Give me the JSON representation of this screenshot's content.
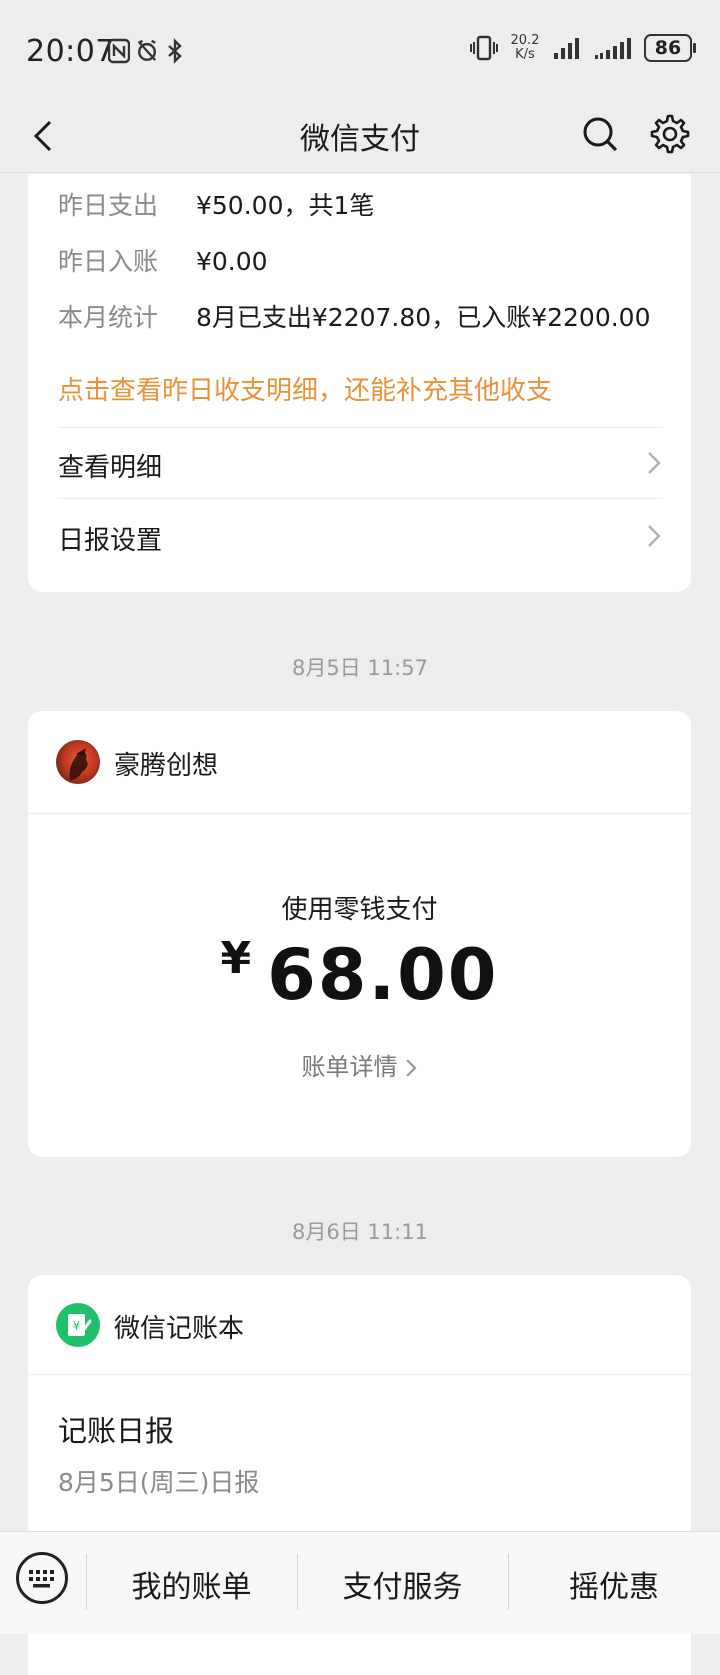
{
  "status": {
    "time": "20:07",
    "net_speed_value": "20.2",
    "net_speed_unit": "K/s",
    "battery": "86"
  },
  "header": {
    "title": "微信支付"
  },
  "summary": {
    "yesterday_out_label": "昨日支出",
    "yesterday_out_value": "¥50.00，共1笔",
    "yesterday_in_label": "昨日入账",
    "yesterday_in_value": "¥0.00",
    "month_label": "本月统计",
    "month_value": "8月已支出¥2207.80，已入账¥2200.00",
    "hint": "点击查看昨日收支明细，还能补充其他收支",
    "view_details": "查看明细",
    "report_settings": "日报设置"
  },
  "timestamps": {
    "first": "8月5日 11:57",
    "second": "8月6日 11:11"
  },
  "payment": {
    "merchant": "豪腾创想",
    "method": "使用零钱支付",
    "currency": "¥",
    "amount": "68.00",
    "detail_link": "账单详情"
  },
  "bookkeeping": {
    "name": "微信记账本",
    "report_title": "记账日报",
    "report_subtitle": "8月5日(周三)日报"
  },
  "bottom_bar": {
    "my_bills": "我的账单",
    "pay_services": "支付服务",
    "shake_deals": "摇优惠"
  },
  "colors": {
    "accent_orange": "#e6933a",
    "wechat_green": "#21c06b",
    "background": "#ededed"
  }
}
